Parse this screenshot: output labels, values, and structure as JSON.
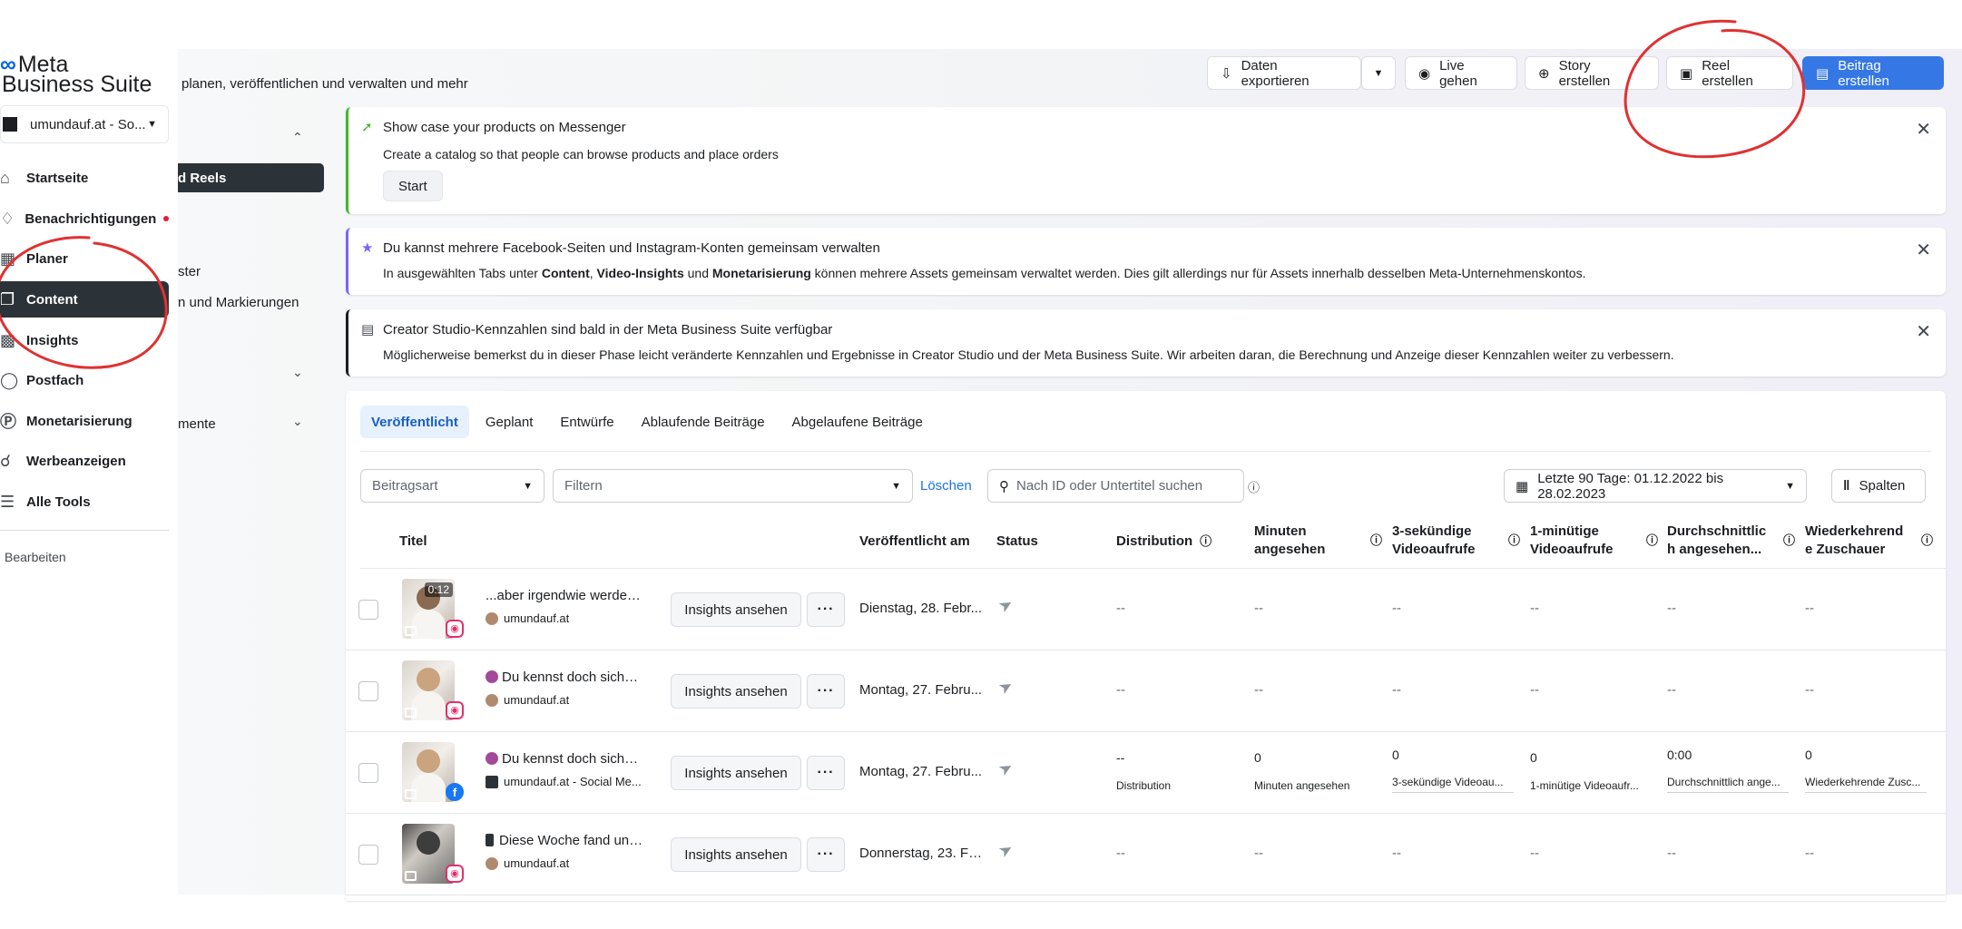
{
  "app": {
    "brand_line1": "Meta",
    "brand_line2": "Business Suite",
    "subtitle": "planen, veröffentlichen und verwalten und mehr",
    "account": "umundauf.at - So..."
  },
  "nav": {
    "items": [
      {
        "label": "Startseite",
        "icon": "home-icon"
      },
      {
        "label": "Benachrichtigungen",
        "icon": "bell-icon",
        "badge_color": "#e41e3f"
      },
      {
        "label": "Planer",
        "icon": "calendar-icon"
      },
      {
        "label": "Content",
        "icon": "content-icon",
        "active": true
      },
      {
        "label": "Insights",
        "icon": "bar-chart-icon"
      },
      {
        "label": "Postfach",
        "icon": "chat-icon"
      },
      {
        "label": "Monetarisierung",
        "icon": "dollar-icon"
      },
      {
        "label": "Werbeanzeigen",
        "icon": "megaphone-icon"
      },
      {
        "label": "Alle Tools",
        "icon": "menu-icon"
      }
    ],
    "edit": "Bearbeiten"
  },
  "subnav": {
    "active": "d Reels",
    "item1": "ster",
    "item2": "n und Markierungen",
    "item3": "mente"
  },
  "toolbar": {
    "export": "Daten exportieren",
    "live": "Live gehen",
    "story": "Story erstellen",
    "reel": "Reel erstellen",
    "post": "Beitrag erstellen",
    "primary_color": "#3578e5"
  },
  "banners": [
    {
      "title": "Show case your products on Messenger",
      "body": "Create a catalog so that people can browse products and place orders",
      "button": "Start",
      "accent": "#42b72a"
    },
    {
      "title": "Du kannst mehrere Facebook-Seiten und Instagram-Konten gemeinsam verwalten",
      "body_1": "In ausgewählten Tabs unter ",
      "body_bold_1": "Content",
      "body_2": ", ",
      "body_bold_2": "Video-Insights",
      "body_3": " und ",
      "body_bold_3": "Monetarisierung",
      "body_4": " können mehrere Assets gemeinsam verwaltet werden. Dies gilt allerdings nur für Assets innerhalb desselben Meta-Unternehmenskontos.",
      "accent": "#7b61ff"
    },
    {
      "title": "Creator Studio-Kennzahlen sind bald in der Meta Business Suite verfügbar",
      "body": "Möglicherweise bemerkst du in dieser Phase leicht veränderte Kennzahlen und Ergebnisse in Creator Studio und der Meta Business Suite. Wir arbeiten daran, die Berechnung und Anzeige dieser Kennzahlen weiter zu verbessern.",
      "accent": "#1c1e21"
    }
  ],
  "tabs": [
    "Veröffentlicht",
    "Geplant",
    "Entwürfe",
    "Ablaufende Beiträge",
    "Abgelaufene Beiträge"
  ],
  "filters": {
    "type_placeholder": "Beitragsart",
    "filter_placeholder": "Filtern",
    "clear": "Löschen",
    "search_placeholder": "Nach ID oder Untertitel suchen",
    "date_range": "Letzte 90 Tage: 01.12.2022 bis 28.02.2023",
    "columns": "Spalten"
  },
  "table": {
    "headers": {
      "title": "Titel",
      "published": "Veröffentlicht am",
      "status": "Status",
      "distribution": "Distribution",
      "minutes": [
        "Minuten",
        "angesehen"
      ],
      "views3s": [
        "3-sekündige",
        "Videoaufrufe"
      ],
      "views1m": [
        "1-minütige",
        "Videoaufrufe"
      ],
      "avg": [
        "Durchschnittlic",
        "h angesehen..."
      ],
      "returning": [
        "Wiederkehrend",
        "e Zuschauer"
      ]
    },
    "insights_label": "Insights ansehen",
    "rows": [
      {
        "title": "...aber irgendwie werden ...",
        "account": "umundauf.at",
        "duration": "0:12",
        "platform": "instagram",
        "date": "Dienstag, 28. Febr...",
        "distribution": "--",
        "minutes": "--",
        "views3s": "--",
        "views1m": "--",
        "avg": "--",
        "returning": "--"
      },
      {
        "title": "Du kennst doch sicher...",
        "account": "umundauf.at",
        "platform": "instagram",
        "date": "Montag, 27. Febru...",
        "distribution": "--",
        "minutes": "--",
        "views3s": "--",
        "views1m": "--",
        "avg": "--",
        "returning": "--"
      },
      {
        "title": "Du kennst doch sicher...",
        "account": "umundauf.at - Social Me...",
        "platform": "facebook",
        "date": "Montag, 27. Febru...",
        "distribution": "--",
        "distribution_label": "Distribution",
        "minutes": "0",
        "minutes_label": "Minuten angesehen",
        "views3s": "0",
        "views3s_label": "3-sekündige Videoau...",
        "views1m": "0",
        "views1m_label": "1-minütige Videoaufr...",
        "avg": "0:00",
        "avg_label": "Durchschnittlich ange...",
        "returning": "0",
        "returning_label": "Wiederkehrende Zusc..."
      },
      {
        "title": "Diese Woche fand uns...",
        "account": "umundauf.at",
        "platform": "instagram",
        "date": "Donnerstag, 23. Fe...",
        "distribution": "--",
        "minutes": "--",
        "views3s": "--",
        "views1m": "--",
        "avg": "--",
        "returning": "--"
      }
    ]
  },
  "annotation_color": "#e03131"
}
